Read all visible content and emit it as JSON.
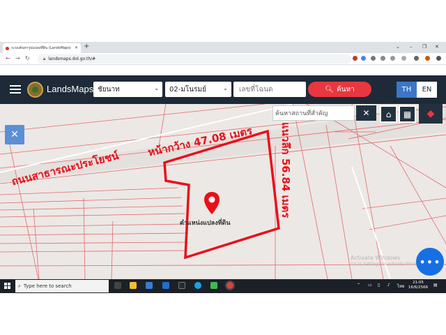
{
  "browser": {
    "tab_title": "ระบบค้นหารูปแปลงที่ดิน (LandsMaps)",
    "new_tab": "+",
    "url": "landsmaps.dol.go.th/#",
    "window_controls": [
      "⌄",
      "–",
      "❐",
      "✕"
    ]
  },
  "header": {
    "brand": "LandsMaps",
    "province": "ชัยนาท",
    "district": "02-มโนรมย์",
    "deed_placeholder": "เลขที่โฉนด",
    "search_label": "ค้นหา",
    "lang_th": "TH",
    "lang_en": "EN",
    "colors": {
      "bar": "#1e2a38",
      "search": "#e8373f",
      "th_active": "#3b76c7"
    }
  },
  "map": {
    "place_search_placeholder": "ค้นหาสถานที่สำคัญ",
    "annotations": {
      "road": "ถนนสาธารณะประโยชน์",
      "frontage": "หน้ากว้าง  47.08  เมตร",
      "depth": "แนวลึก  56.84  เมตร",
      "parcel_label": "ตำแหน่งแปลงที่ดิน"
    },
    "watermark_line1": "Activate Windows",
    "watermark_line2": "Go to Settings to activate Windows.",
    "fab_label": "•••",
    "icons": [
      "home-icon",
      "grid-icon",
      "layers-icon",
      "tools-icon",
      "map-pin-icon"
    ],
    "colors": {
      "parcel": "#e8101a",
      "lines": "#e06a6a",
      "background": "#ece8e5"
    }
  },
  "taskbar": {
    "search_placeholder": "Type here to search",
    "time": "21:05",
    "date": "16/6/2566",
    "lang": "ไทย"
  }
}
